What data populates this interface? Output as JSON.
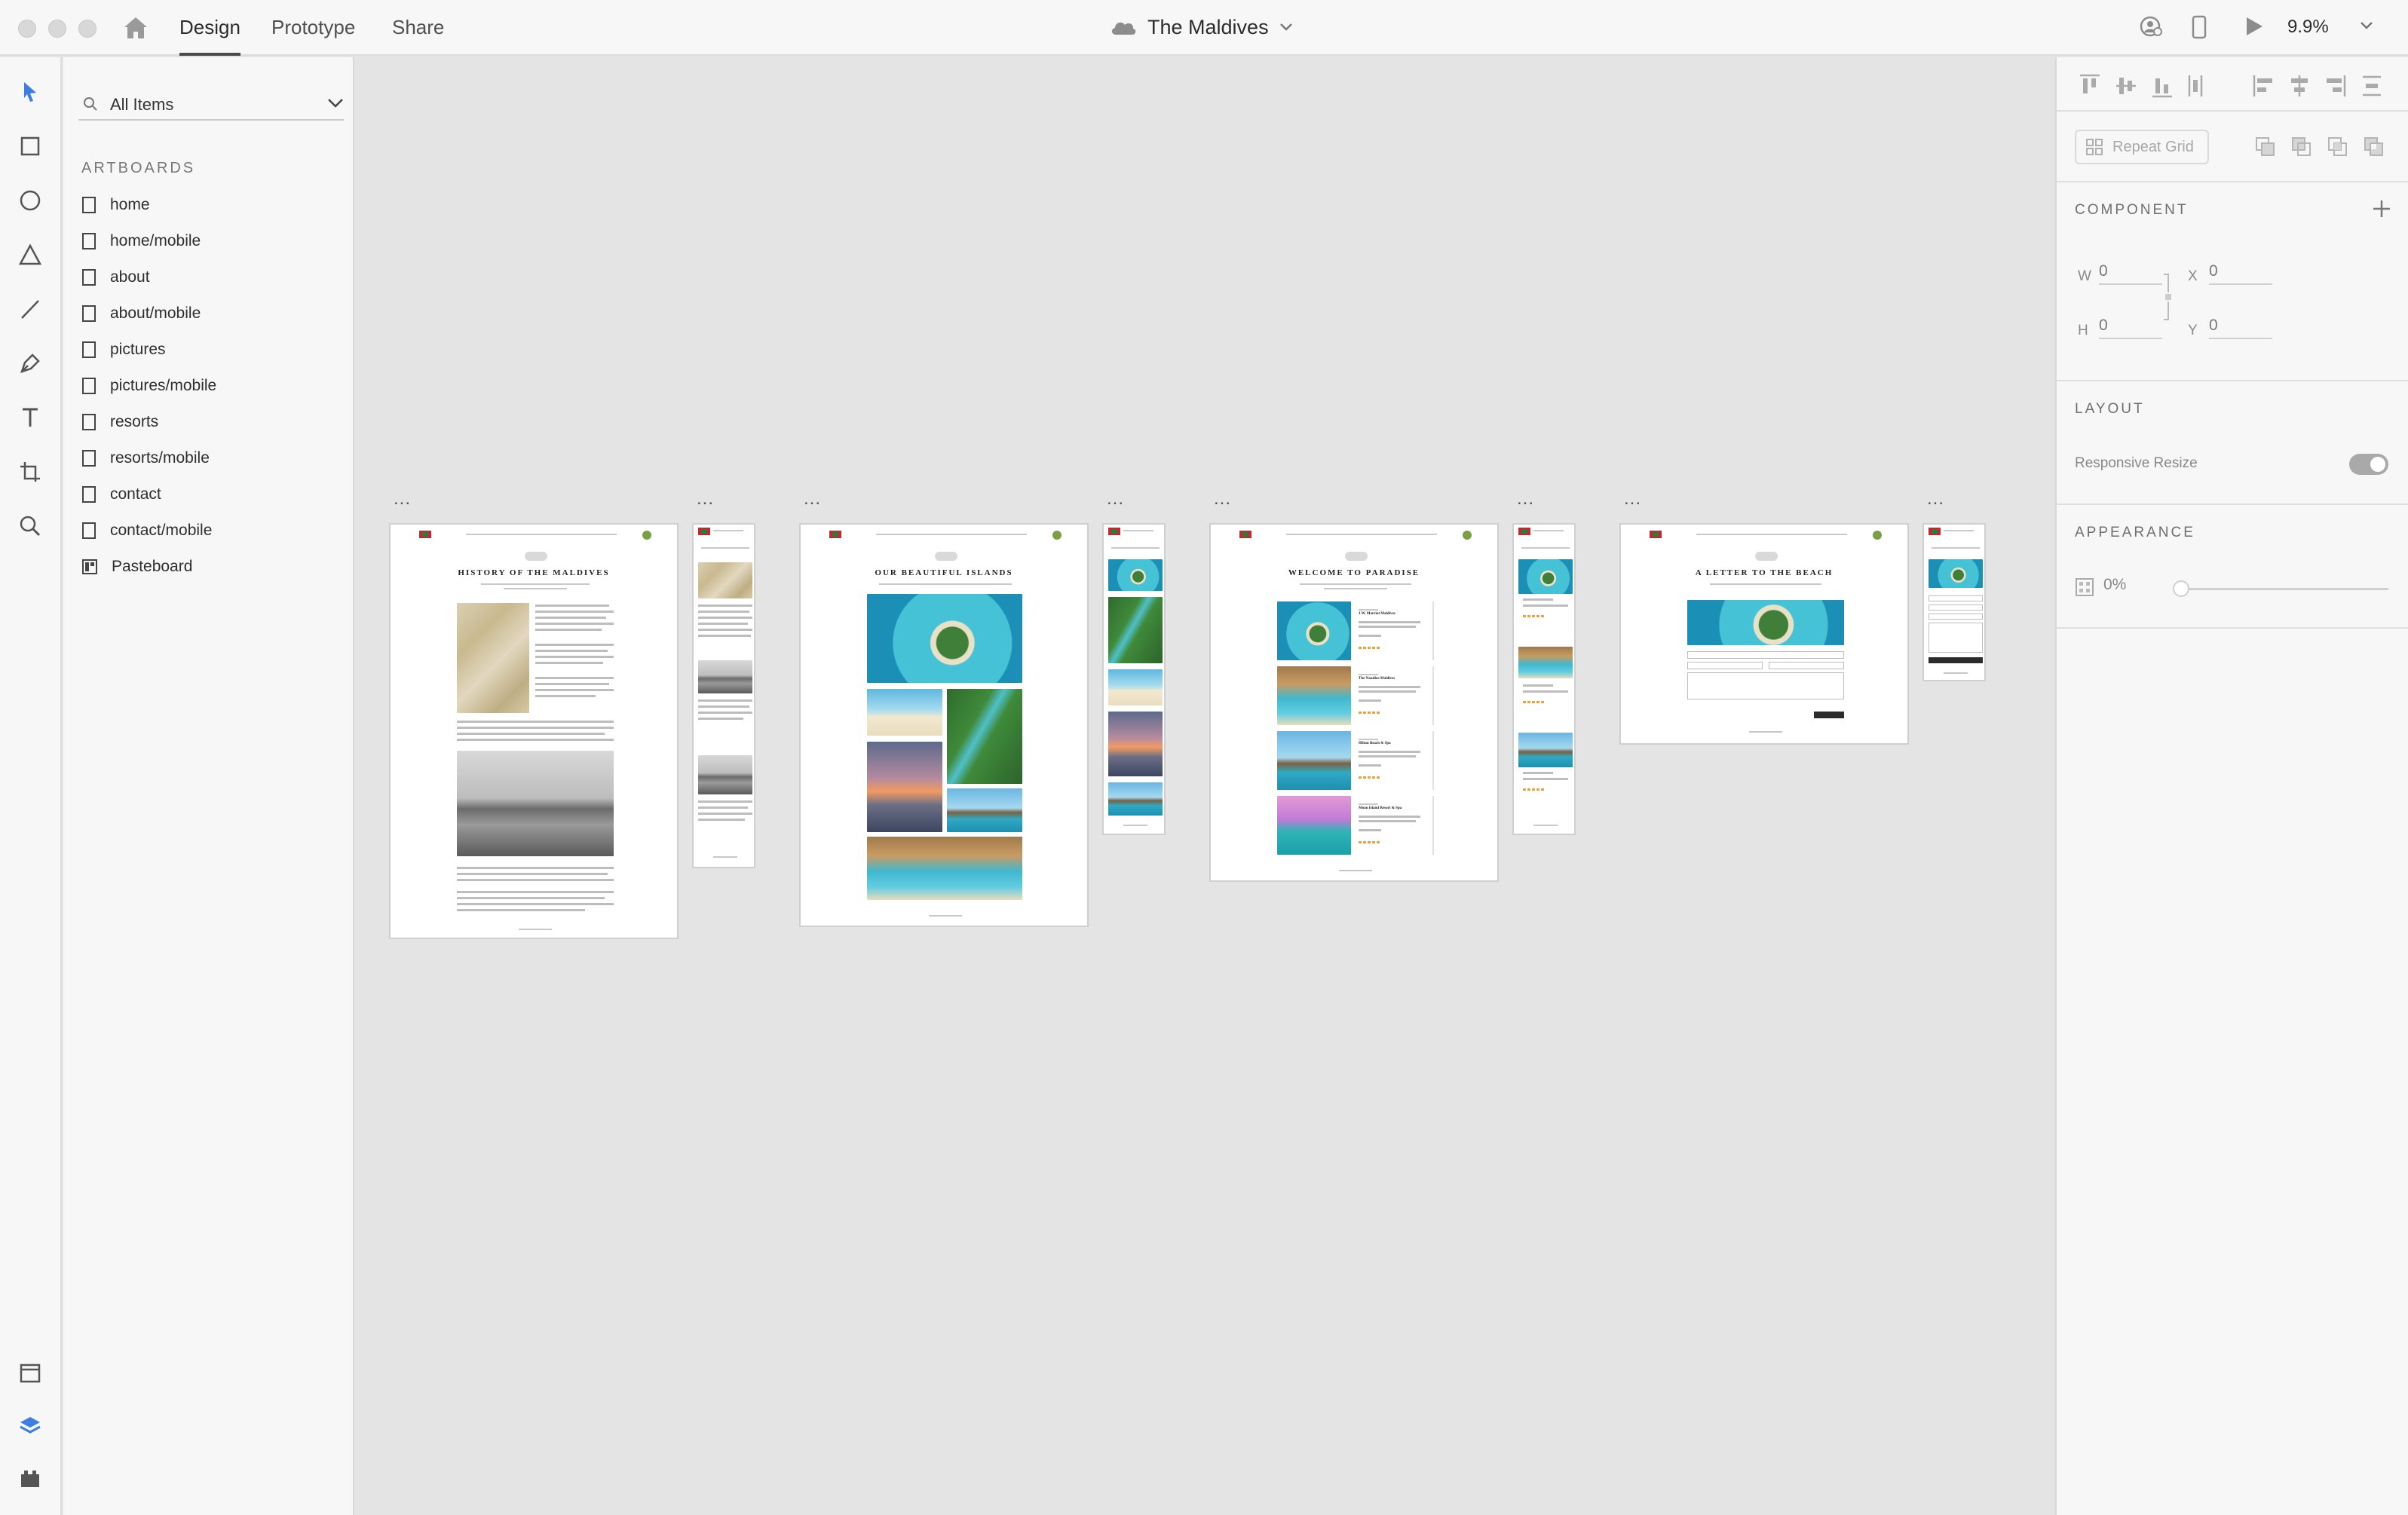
{
  "window": {
    "title": "The Maldives",
    "tabs": [
      {
        "label": "Design",
        "active": true
      },
      {
        "label": "Prototype",
        "active": false
      },
      {
        "label": "Share",
        "active": false
      }
    ],
    "zoom": "9.9%"
  },
  "toolbar_icons": [
    "select-icon",
    "rectangle-icon",
    "ellipse-icon",
    "polygon-icon",
    "line-icon",
    "pen-icon",
    "text-icon",
    "artboard-icon",
    "zoom-icon"
  ],
  "bottom_icons": [
    "assets-icon",
    "layers-icon",
    "plugins-icon"
  ],
  "layers_panel": {
    "filter_label": "All Items",
    "section_title": "ARTBOARDS",
    "items": [
      {
        "label": "home",
        "icon": "artboard-icon"
      },
      {
        "label": "home/mobile",
        "icon": "artboard-icon"
      },
      {
        "label": "about",
        "icon": "artboard-icon"
      },
      {
        "label": "about/mobile",
        "icon": "artboard-icon"
      },
      {
        "label": "pictures",
        "icon": "artboard-icon"
      },
      {
        "label": "pictures/mobile",
        "icon": "artboard-icon"
      },
      {
        "label": "resorts",
        "icon": "artboard-icon"
      },
      {
        "label": "resorts/mobile",
        "icon": "artboard-icon"
      },
      {
        "label": "contact",
        "icon": "artboard-icon"
      },
      {
        "label": "contact/mobile",
        "icon": "artboard-icon"
      },
      {
        "label": "Pasteboard",
        "icon": "pasteboard-icon"
      }
    ]
  },
  "canvas": {
    "artboard_menu": "...",
    "artboards": [
      {
        "heading": "HISTORY OF THE MALDIVES"
      },
      {
        "heading": "OUR BEAUTIFUL ISLANDS"
      },
      {
        "heading": "WELCOME TO PARADISE"
      },
      {
        "heading": "A LETTER TO THE BEACH"
      }
    ],
    "resort_cards": [
      "J.W. Marriot Maldives",
      "The Nautilus Maldives",
      "Hilton Beach & Spa",
      "Moon Island Resort & Spa"
    ]
  },
  "properties": {
    "repeat_grid": "Repeat Grid",
    "component_title": "COMPONENT",
    "fields": {
      "w_label": "W",
      "w": "0",
      "x_label": "X",
      "x": "0",
      "h_label": "H",
      "h": "0",
      "y_label": "Y",
      "y": "0"
    },
    "layout_title": "LAYOUT",
    "responsive_resize": "Responsive Resize",
    "responsive_resize_on": true,
    "appearance_title": "APPEARANCE",
    "opacity": "0%"
  },
  "colors": {
    "accent": "#3b7ee4",
    "panel_bg": "#f7f7f7",
    "canvas_bg": "#e4e4e4"
  }
}
